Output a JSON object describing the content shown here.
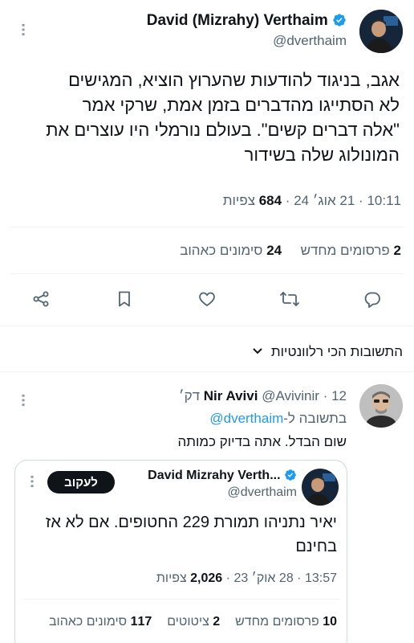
{
  "tweet": {
    "author_name": "David (Mizrahy) Verthaim",
    "author_handle": "@dverthaim",
    "body_lines": [
      "אגב, בניגוד להודעות שהערוץ הוציא, המגישים",
      "לא הסתייגו מהדברים בזמן אמת, שרקי אמר",
      "\"אלה דברים קשים\". בעולם נורמלי היו עוצרים את",
      "המונולוג שלה בשידור"
    ],
    "time": "10:11",
    "date": "21 אוג׳ 24",
    "views_count": "684",
    "views_label": "צפיות",
    "reposts_count": "2",
    "reposts_label": "פרסומים מחדש",
    "likes_count": "24",
    "likes_label": "סימונים כאהוב"
  },
  "actions": [
    "share-icon",
    "bookmark-icon",
    "like-icon",
    "retweet-icon",
    "reply-icon"
  ],
  "replies_sort": {
    "label": "התשובות הכי רלוונטיות"
  },
  "reply": {
    "author_name": "Nir Avivi",
    "author_handle": "@Avivinir",
    "time_ago": "12 דק׳",
    "in_reply_prefix": "בתשובה ל-",
    "in_reply_handle": "@dverthaim",
    "body": "שום הבדל. אתה בדיוק כמותה"
  },
  "quoted": {
    "author_name": "David Mizrahy Verth...",
    "author_handle": "@dverthaim",
    "follow_label": "לעקוב",
    "body_lines": [
      "יאיר נתניהו תמורת 229 החטופים. אם לא אז",
      "בחינם"
    ],
    "time": "13:57",
    "date": "28 אוק׳ 23",
    "views_count": "2,026",
    "views_label": "צפיות",
    "reposts_count": "10",
    "reposts_label": "פרסומים מחדש",
    "quotes_count": "2",
    "quotes_label": "ציטוטים",
    "likes_count": "117",
    "likes_label": "סימונים כאהוב"
  },
  "colors": {
    "accent": "#1d9bf0",
    "muted": "#536471",
    "divider": "#eff3f4"
  }
}
